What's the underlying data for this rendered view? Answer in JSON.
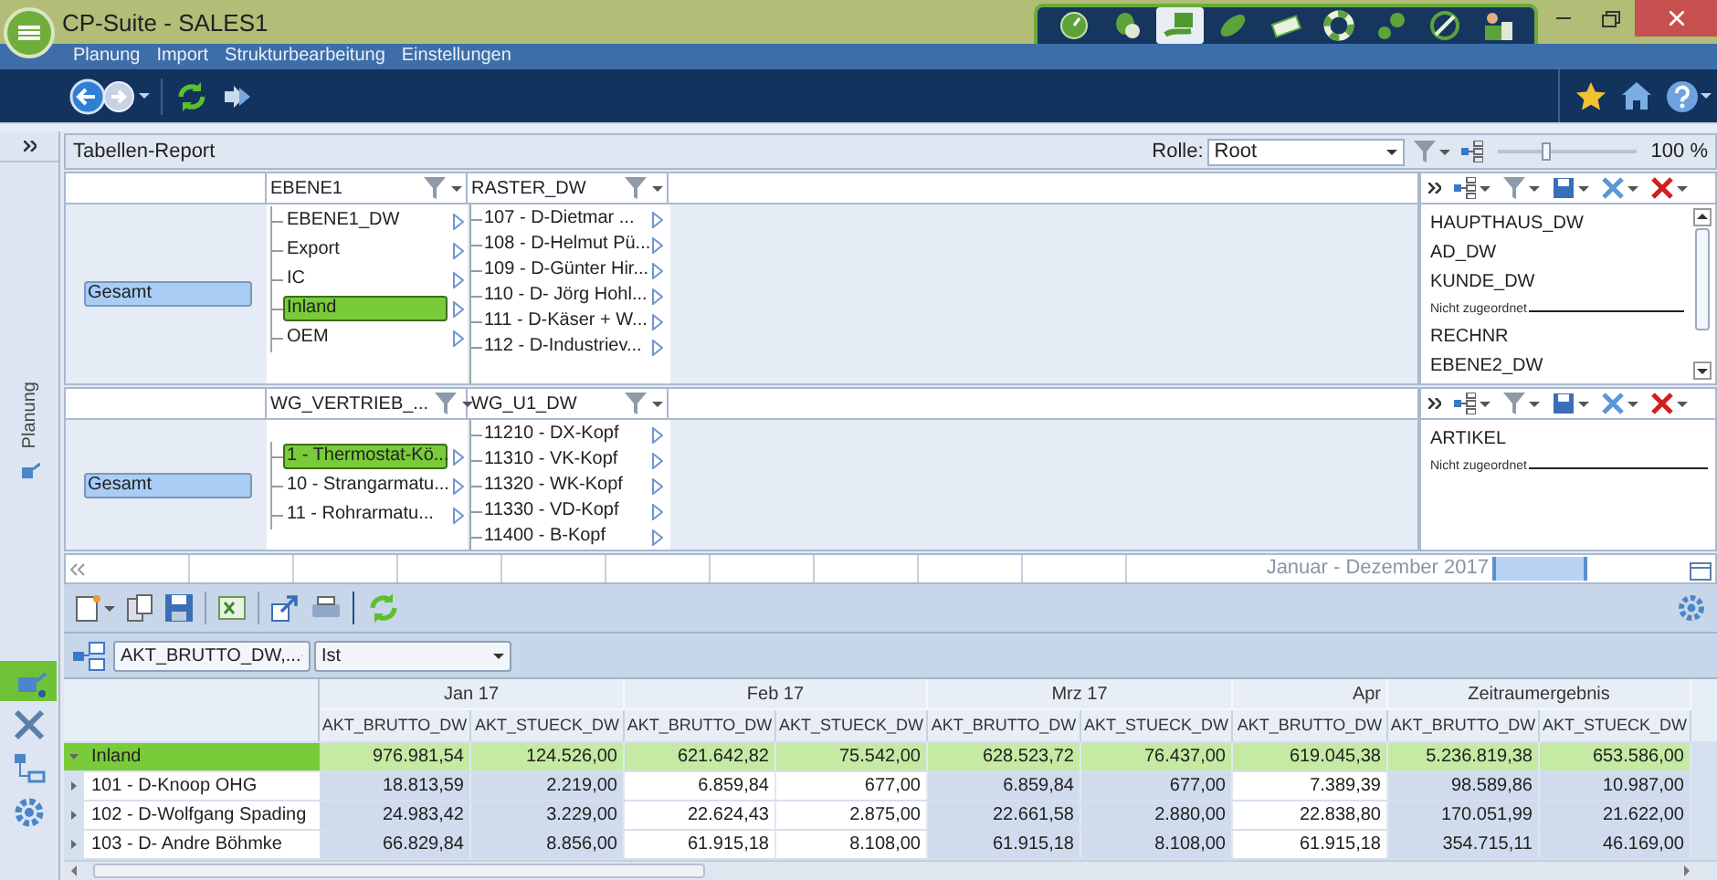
{
  "window": {
    "title": "CP-Suite - SALES1"
  },
  "module_tabs": [
    {
      "selected": false
    },
    {
      "selected": false
    },
    {
      "selected": true
    },
    {
      "selected": false
    },
    {
      "selected": false
    },
    {
      "selected": false
    },
    {
      "selected": false
    },
    {
      "selected": false
    },
    {
      "selected": false
    }
  ],
  "menu": [
    "Planung",
    "Import",
    "Strukturbearbeitung",
    "Einstellungen"
  ],
  "sidebar": {
    "label": "Planung",
    "items": [
      {
        "selected": true
      },
      {
        "selected": false
      },
      {
        "selected": false
      },
      {
        "selected": false
      }
    ]
  },
  "report": {
    "title": "Tabellen-Report",
    "role_label": "Rolle:",
    "role": "Root",
    "zoom": {
      "level": 0.35,
      "reading": "100 %"
    }
  },
  "panels": [
    {
      "columns": [
        "EBENE1",
        "RASTER_DW"
      ],
      "root": "Gesamt",
      "level_2": [
        {
          "label": "EBENE1_DW",
          "selected": false
        },
        {
          "label": "Export",
          "selected": false
        },
        {
          "label": "IC",
          "selected": false
        },
        {
          "label": "Inland",
          "selected": true
        },
        {
          "label": "OEM",
          "selected": false
        }
      ],
      "level_3": [
        "107 - D-Dietmar ...",
        "108 - D-Helmut Pü...",
        "109 - D-Günter Hir...",
        "110 - D- Jörg Hohl...",
        "111 - D-Käser + W...",
        "112 - D-Industriev..."
      ],
      "fields": [
        {
          "kind": "field",
          "label": "HAUPTHAUS_DW"
        },
        {
          "kind": "field",
          "label": "AD_DW"
        },
        {
          "kind": "field",
          "label": "KUNDE_DW"
        },
        {
          "kind": "separator",
          "label": "Nicht zugeordnet"
        },
        {
          "kind": "field",
          "label": "RECHNR"
        },
        {
          "kind": "field",
          "label": "EBENE2_DW"
        }
      ]
    },
    {
      "columns": [
        "WG_VERTRIEB_...",
        "WG_U1_DW"
      ],
      "root": "Gesamt",
      "level_2": [
        {
          "label": "1 - Thermostat-Kö...",
          "selected": true
        },
        {
          "label": "10 - Strangarmatu...",
          "selected": false
        },
        {
          "label": "11 - Rohrarmatu...",
          "selected": false
        }
      ],
      "level_3": [
        "11210 - DX-Kopf",
        "11310 - VK-Kopf",
        "11320 - WK-Kopf",
        "11330 - VD-Kopf",
        "11400 - B-Kopf"
      ],
      "fields": [
        {
          "kind": "field",
          "label": "ARTIKEL"
        },
        {
          "kind": "separator",
          "label": "Nicht zugeordnet"
        }
      ]
    }
  ],
  "timeline": {
    "range": "Januar - Dezember 2017"
  },
  "filters": {
    "measure": "AKT_BRUTTO_DW,...",
    "version": "Ist"
  },
  "table": {
    "groups": [
      {
        "label": "Jan 17",
        "columns": [
          "AKT_BRUTTO_DW",
          "AKT_STUECK_DW"
        ]
      },
      {
        "label": "Feb 17",
        "columns": [
          "AKT_BRUTTO_DW",
          "AKT_STUECK_DW"
        ]
      },
      {
        "label": "Mrz 17",
        "columns": [
          "AKT_BRUTTO_DW",
          "AKT_STUECK_DW"
        ]
      },
      {
        "label": "Apr",
        "columns": [
          "AKT_BRUTTO_DW"
        ]
      },
      {
        "label": "Zeitraumergebnis",
        "columns": [
          "AKT_BRUTTO_DW",
          "AKT_STUECK_DW"
        ]
      }
    ],
    "rows": [
      {
        "label": "Inland",
        "selected": true,
        "expanded": true,
        "values": [
          "976.981,54",
          "124.526,00",
          "621.642,82",
          "75.542,00",
          "628.523,72",
          "76.437,00",
          "619.045,38",
          "5.236.819,38",
          "653.586,00"
        ]
      },
      {
        "label": "101 - D-Knoop OHG",
        "selected": false,
        "expanded": false,
        "values": [
          "18.813,59",
          "2.219,00",
          "6.859,84",
          "677,00",
          "6.859,84",
          "677,00",
          "7.389,39",
          "98.589,86",
          "10.987,00"
        ]
      },
      {
        "label": "102 - D-Wolfgang Spading",
        "selected": false,
        "expanded": false,
        "values": [
          "24.983,42",
          "3.229,00",
          "22.624,43",
          "2.875,00",
          "22.661,58",
          "2.880,00",
          "22.838,80",
          "170.051,99",
          "21.622,00"
        ]
      },
      {
        "label": "103 - D- Andre Böhmke",
        "selected": false,
        "expanded": false,
        "values": [
          "66.829,84",
          "8.856,00",
          "61.915,18",
          "8.108,00",
          "61.915,18",
          "8.108,00",
          "61.915,18",
          "354.715,11",
          "46.169,00"
        ]
      }
    ]
  }
}
